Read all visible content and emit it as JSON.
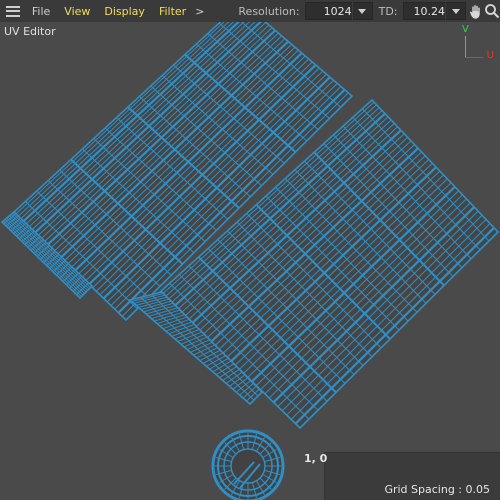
{
  "menu": {
    "items": [
      "File",
      "View",
      "Display",
      "Filter"
    ],
    "more": ">"
  },
  "toolbar": {
    "resolution_label": "Resolution:",
    "resolution_value": "1024",
    "td_label": "TD:",
    "td_value": "10.24"
  },
  "viewport": {
    "editor_label": "UV Editor",
    "axis_v": "V",
    "axis_u": "U",
    "coord_readout": "1, 0",
    "grid_spacing": "Grid Spacing : 0.05"
  },
  "colors": {
    "wire": "#2f8fc6",
    "background": "#4a4a4a",
    "menu_highlight": "#f3dd5d",
    "axis_v": "#2fd64d",
    "axis_u": "#e6362e"
  },
  "icons": {
    "menu": "hamburger-icon",
    "hand": "hand-pan-icon",
    "dropdown": "chevron-down-icon"
  }
}
